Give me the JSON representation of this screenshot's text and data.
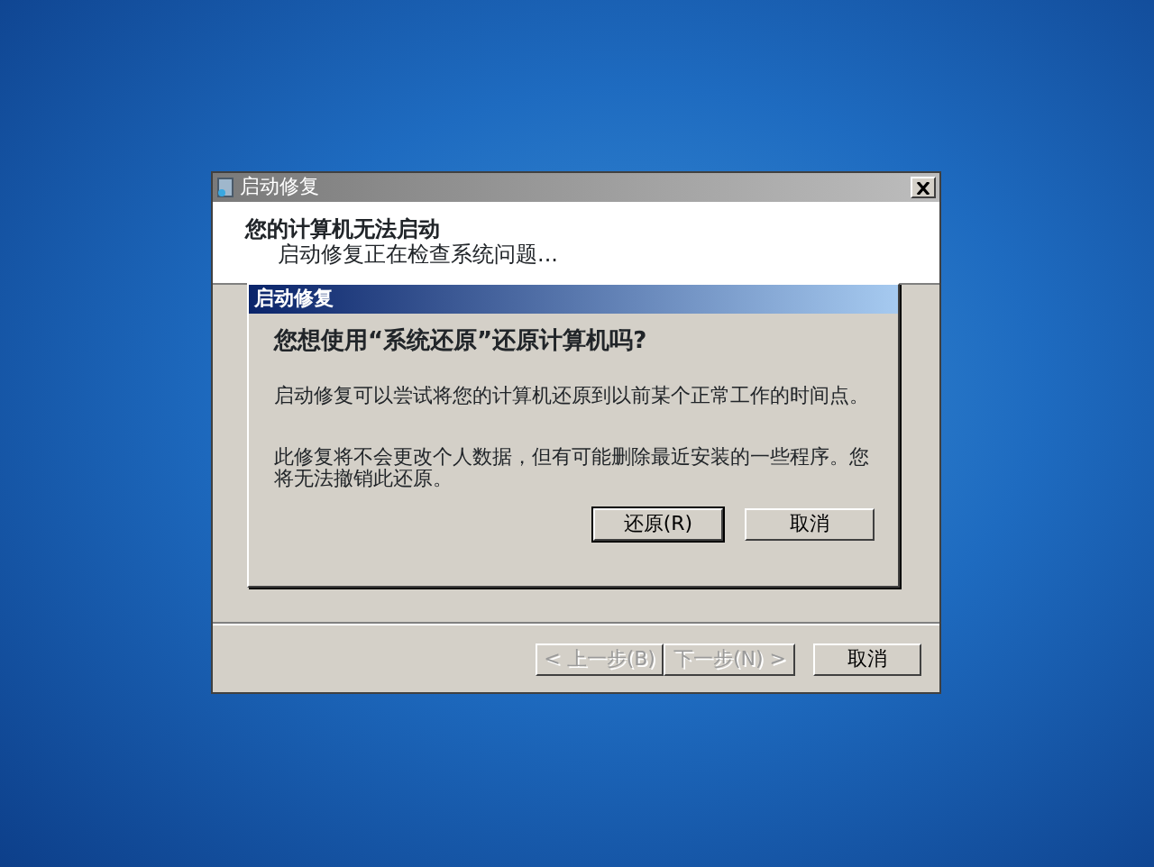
{
  "window": {
    "title": "启动修复",
    "heading": "您的计算机无法启动",
    "subheading": "启动修复正在检查系统问题...",
    "buttons": [
      {
        "label": "< 上一步(B)",
        "disabled": true
      },
      {
        "label": "下一步(N) >",
        "disabled": true
      },
      {
        "label": "取消",
        "disabled": false
      }
    ]
  },
  "dialog": {
    "title": "启动修复",
    "question": "您想使用“系统还原”还原计算机吗?",
    "paragraphs": [
      "启动修复可以尝试将您的计算机还原到以前某个正常工作的时间点。",
      "此修复将不会更改个人数据，但有可能删除最近安装的一些程序。您将无法撤销此还原。"
    ],
    "buttons": [
      {
        "label": "还原(R)",
        "default": true
      },
      {
        "label": "取消",
        "default": false
      }
    ]
  }
}
